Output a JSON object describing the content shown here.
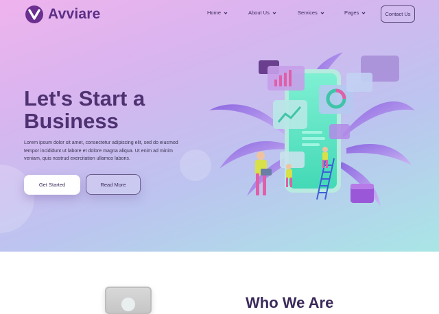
{
  "brand": {
    "name": "Avviare"
  },
  "nav": {
    "items": [
      {
        "label": "Home"
      },
      {
        "label": "About Us"
      },
      {
        "label": "Services"
      },
      {
        "label": "Pages"
      }
    ],
    "contact_label": "Contact Us"
  },
  "hero": {
    "title_line1": "Let's Start a",
    "title_line2": "Business",
    "description": "Lorem ipsum dolor sit amet, consectetur adipiscing elit, sed do eiusmod tempor incididunt ut labore et dolore magna aliqua. Ut enim ad minim veniam, quis nostrud exercitation ullamco laboris.",
    "primary_button": "Get Started",
    "secondary_button": "Read More"
  },
  "about": {
    "heading": "Who We Are"
  },
  "colors": {
    "brand": "#5b2f86",
    "heading": "#4e3170",
    "hero_gradient_start": "#efb3ee",
    "hero_gradient_end": "#a9e6e6"
  },
  "icons": {
    "logo": "avviare-logo-icon",
    "nav_dropdown": "chevron-down-icon"
  }
}
